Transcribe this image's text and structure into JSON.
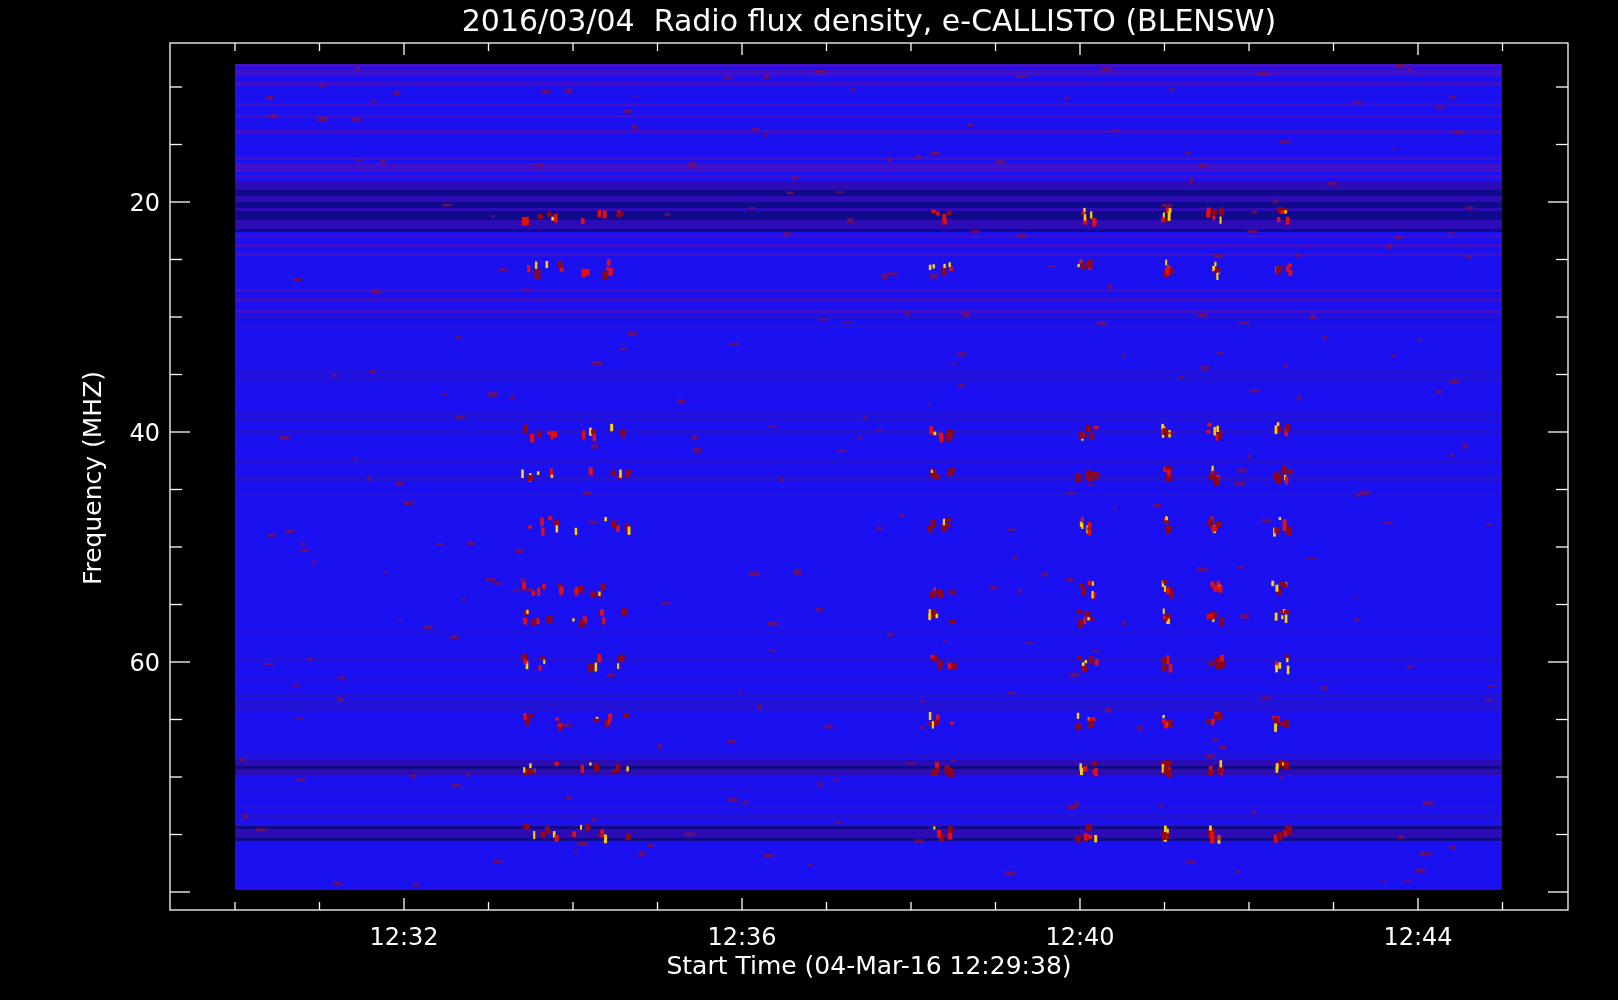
{
  "plot": {
    "title": "2016/03/04  Radio flux density, e-CALLISTO (BLENSW)",
    "xlabel": "Start Time (04-Mar-16 12:29:38)",
    "ylabel": "Frequency (MHZ)",
    "xtick_labels": [
      "12:32",
      "12:36",
      "12:40",
      "12:44"
    ],
    "ytick_labels": [
      "20",
      "40",
      "60"
    ]
  }
}
